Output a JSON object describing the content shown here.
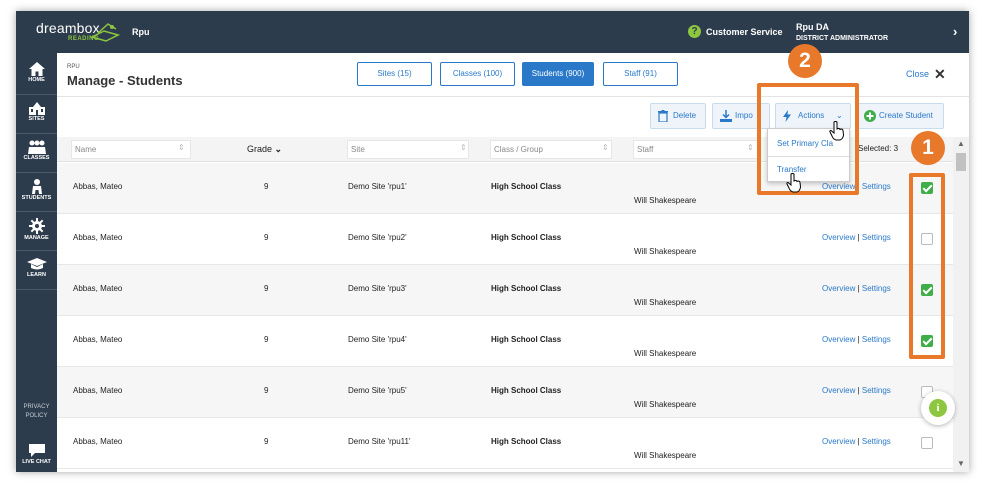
{
  "topbar": {
    "logo_text": "dreambox",
    "logo_sub": "READING",
    "org_name": "Rpu",
    "customer_service": "Customer Service",
    "help_glyph": "?",
    "user_name": "Rpu DA",
    "user_role": "DISTRICT ADMINISTRATOR"
  },
  "sidebar": {
    "items": [
      {
        "label": "HOME",
        "icon": "home-icon"
      },
      {
        "label": "SITES",
        "icon": "school-icon"
      },
      {
        "label": "CLASSES",
        "icon": "group-icon"
      },
      {
        "label": "STUDENTS",
        "icon": "student-icon"
      },
      {
        "label": "MANAGE",
        "icon": "gear-icon"
      },
      {
        "label": "LEARN",
        "icon": "graduation-cap-icon"
      }
    ],
    "privacy_line1": "PRIVACY",
    "privacy_line2": "POLICY",
    "live_chat": "LIVE CHAT"
  },
  "header": {
    "crumb": "RPU",
    "title": "Manage - Students",
    "tabs": [
      {
        "label": "Sites (15)"
      },
      {
        "label": "Classes (100)"
      },
      {
        "label": "Students (900)"
      },
      {
        "label": "Staff (91)"
      }
    ],
    "close_label": "Close",
    "close_glyph": "✕"
  },
  "toolbar": {
    "delete_label": "Delete",
    "import_label": "Impo",
    "actions_label": "Actions",
    "create_label": "Create Student"
  },
  "actions_menu": {
    "items": [
      "Set Primary Cla",
      "Transfer"
    ]
  },
  "table": {
    "filters": {
      "name": "Name",
      "grade": "Grade",
      "site": "Site",
      "class": "Class / Group",
      "staff": "Staff"
    },
    "selected_label": "Selected: 3",
    "overview_label": "Overview",
    "sep": "|",
    "settings_label": "Settings",
    "rows": [
      {
        "name": "Abbas, Mateo",
        "grade": "9",
        "site": "Demo Site 'rpu1'",
        "class": "High School Class",
        "staff": "Will Shakespeare",
        "checked": true
      },
      {
        "name": "Abbas, Mateo",
        "grade": "9",
        "site": "Demo Site 'rpu2'",
        "class": "High School Class",
        "staff": "Will Shakespeare",
        "checked": false
      },
      {
        "name": "Abbas, Mateo",
        "grade": "9",
        "site": "Demo Site 'rpu3'",
        "class": "High School Class",
        "staff": "Will Shakespeare",
        "checked": true
      },
      {
        "name": "Abbas, Mateo",
        "grade": "9",
        "site": "Demo Site 'rpu4'",
        "class": "High School Class",
        "staff": "Will Shakespeare",
        "checked": true
      },
      {
        "name": "Abbas, Mateo",
        "grade": "9",
        "site": "Demo Site 'rpu5'",
        "class": "High School Class",
        "staff": "Will Shakespeare",
        "checked": false
      },
      {
        "name": "Abbas, Mateo",
        "grade": "9",
        "site": "Demo Site 'rpu11'",
        "class": "High School Class",
        "staff": "Will Shakespeare",
        "checked": false
      }
    ]
  },
  "info_glyph": "i",
  "annotations": {
    "one": "1",
    "two": "2",
    "color": "#e8782a"
  },
  "colors": {
    "nav_bg": "#2d3c4c",
    "accent_blue": "#2a79c9",
    "brand_green": "#8dc63f",
    "check_green": "#3fae49"
  }
}
